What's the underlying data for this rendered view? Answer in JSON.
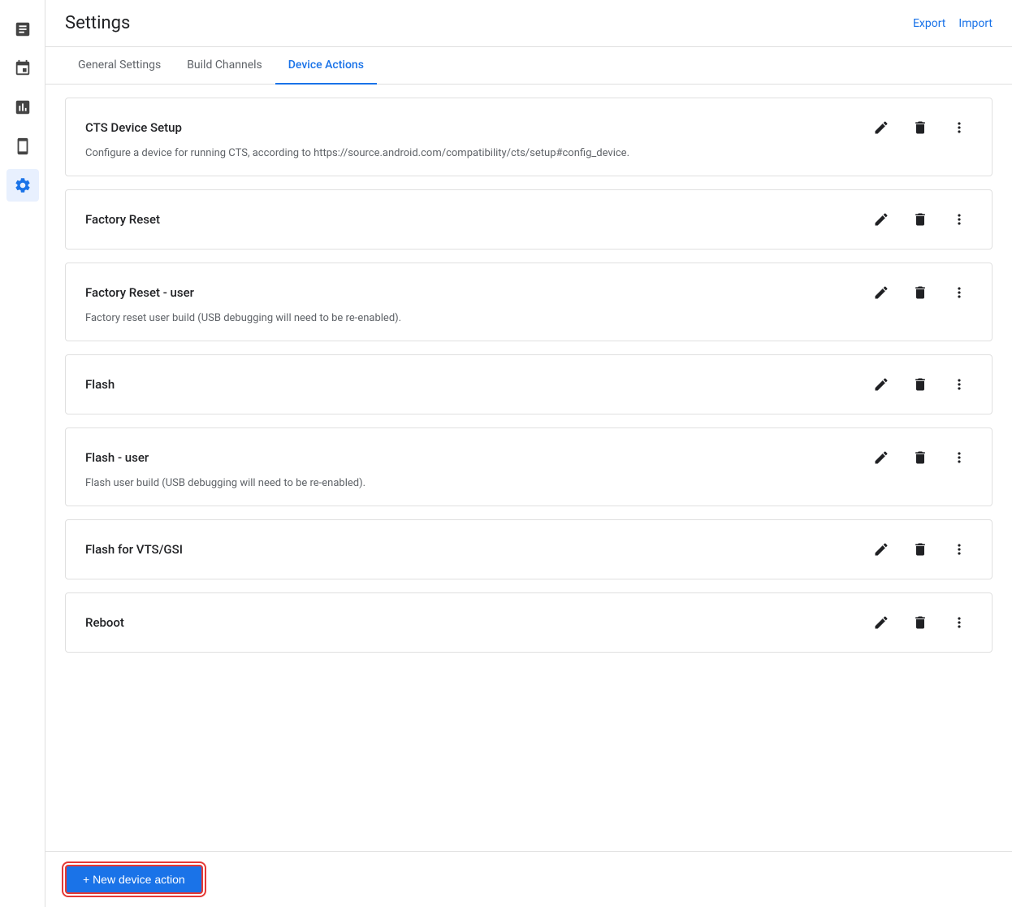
{
  "page": {
    "title": "Settings",
    "export_label": "Export",
    "import_label": "Import"
  },
  "sidebar": {
    "items": [
      {
        "id": "reports",
        "icon": "📋",
        "label": "Reports",
        "active": false
      },
      {
        "id": "calendar",
        "icon": "📅",
        "label": "Calendar",
        "active": false
      },
      {
        "id": "analytics",
        "icon": "📊",
        "label": "Analytics",
        "active": false
      },
      {
        "id": "devices",
        "icon": "📱",
        "label": "Devices",
        "active": false
      },
      {
        "id": "settings",
        "icon": "⚙",
        "label": "Settings",
        "active": true
      }
    ]
  },
  "tabs": [
    {
      "id": "general",
      "label": "General Settings",
      "active": false
    },
    {
      "id": "build-channels",
      "label": "Build Channels",
      "active": false
    },
    {
      "id": "device-actions",
      "label": "Device Actions",
      "active": true
    }
  ],
  "device_actions": [
    {
      "id": 1,
      "title": "CTS Device Setup",
      "description": "Configure a device for running CTS, according to https://source.android.com/compatibility/cts/setup#config_device."
    },
    {
      "id": 2,
      "title": "Factory Reset",
      "description": ""
    },
    {
      "id": 3,
      "title": "Factory Reset - user",
      "description": "Factory reset user build (USB debugging will need to be re-enabled)."
    },
    {
      "id": 4,
      "title": "Flash",
      "description": ""
    },
    {
      "id": 5,
      "title": "Flash - user",
      "description": "Flash user build (USB debugging will need to be re-enabled)."
    },
    {
      "id": 6,
      "title": "Flash for VTS/GSI",
      "description": ""
    },
    {
      "id": 7,
      "title": "Reboot",
      "description": ""
    }
  ],
  "bottom_bar": {
    "new_action_label": "+ New device action"
  }
}
